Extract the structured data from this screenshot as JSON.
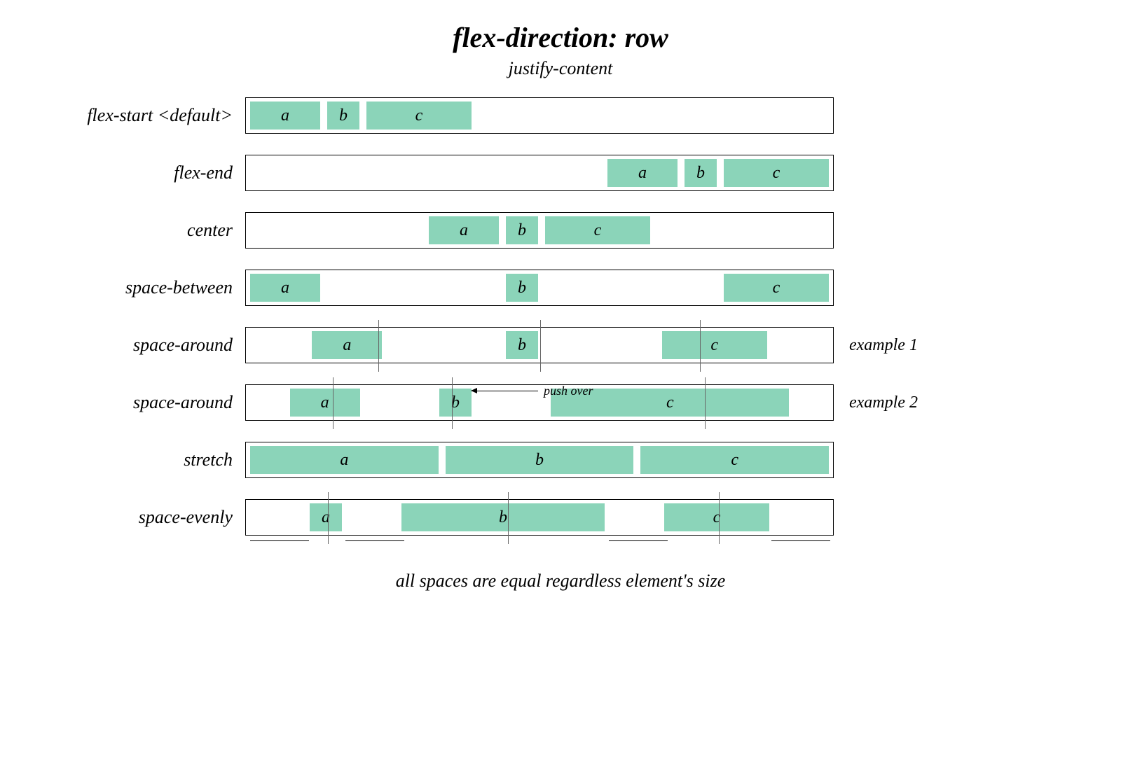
{
  "title": "flex-direction: row",
  "subtitle": "justify-content",
  "rows": [
    {
      "key": "flex_start",
      "label": "flex-start <default>"
    },
    {
      "key": "flex_end",
      "label": "flex-end"
    },
    {
      "key": "center",
      "label": "center"
    },
    {
      "key": "space_between",
      "label": "space-between"
    },
    {
      "key": "space_around1",
      "label": "space-around",
      "after": "example 1"
    },
    {
      "key": "space_around2",
      "label": "space-around",
      "after": "example 2"
    },
    {
      "key": "stretch",
      "label": "stretch"
    },
    {
      "key": "space_evenly",
      "label": "space-evenly"
    }
  ],
  "boxes": {
    "a": "a",
    "b": "b",
    "c": "c"
  },
  "push_over": "push over",
  "footer": "all spaces are equal regardless element's size",
  "chart_data": {
    "type": "table",
    "title": "justify-content values for flex-direction: row",
    "series": [
      {
        "name": "flex-start",
        "note": "default",
        "items": [
          "a",
          "b",
          "c"
        ],
        "layout": "items packed to start"
      },
      {
        "name": "flex-end",
        "items": [
          "a",
          "b",
          "c"
        ],
        "layout": "items packed to end"
      },
      {
        "name": "center",
        "items": [
          "a",
          "b",
          "c"
        ],
        "layout": "items centered"
      },
      {
        "name": "space-between",
        "items": [
          "a",
          "b",
          "c"
        ],
        "layout": "equal space between, none at edges"
      },
      {
        "name": "space-around",
        "example": 1,
        "items": [
          "a",
          "b",
          "c"
        ],
        "layout": "equal space around each item (half at edges)"
      },
      {
        "name": "space-around",
        "example": 2,
        "items": [
          "a",
          "b",
          "c"
        ],
        "layout": "wide item c pushes b leftward",
        "annotation": "push over"
      },
      {
        "name": "stretch",
        "items": [
          "a",
          "b",
          "c"
        ],
        "layout": "items stretch to fill line"
      },
      {
        "name": "space-evenly",
        "items": [
          "a",
          "b",
          "c"
        ],
        "layout": "all gaps + edges equal regardless of item size"
      }
    ]
  }
}
